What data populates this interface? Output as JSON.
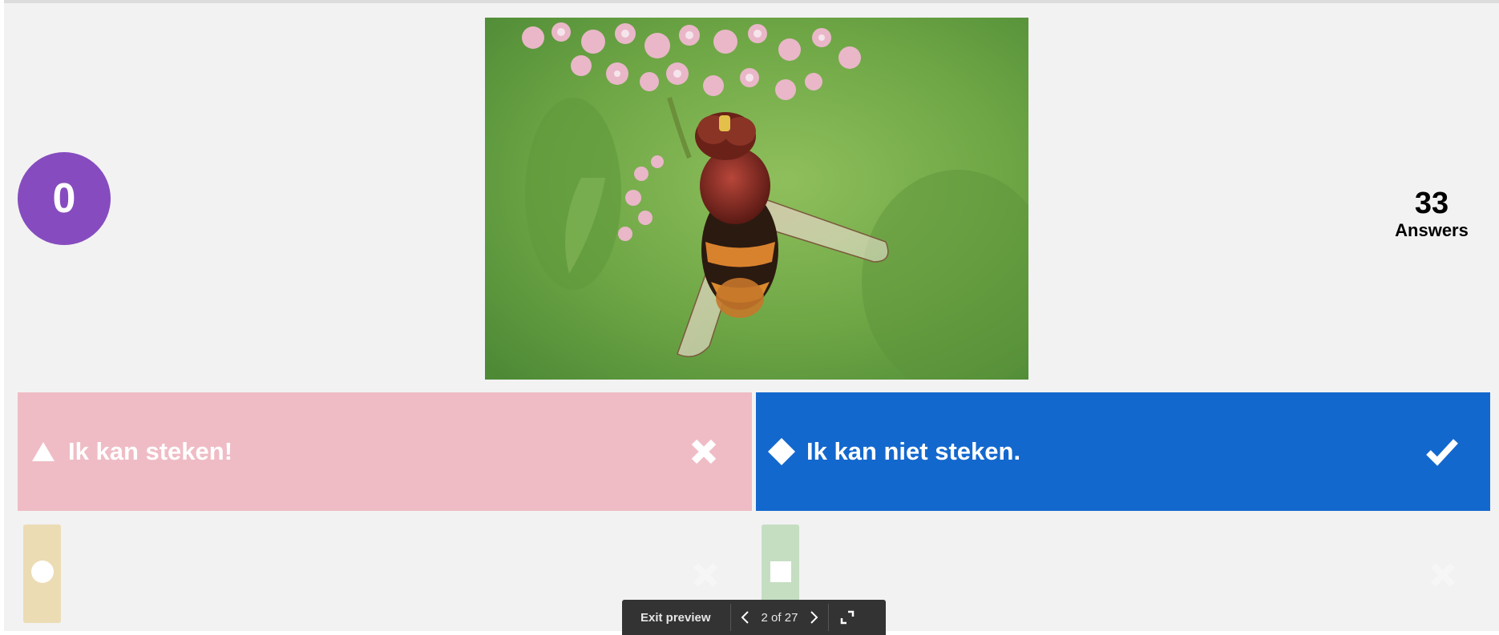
{
  "score": {
    "value": "0",
    "color": "#864cbf"
  },
  "answers_count": {
    "number": "33",
    "label": "Answers"
  },
  "question_image": {
    "subject": "hoverfly on pink flowers",
    "icon": "photo"
  },
  "answers": [
    {
      "shape": "triangle-icon",
      "text": "Ik kan steken!",
      "correct": false,
      "color": "#efbcc5",
      "mark": "cross-icon"
    },
    {
      "shape": "diamond-icon",
      "text": "Ik kan niet steken.",
      "correct": true,
      "color": "#1368ce",
      "mark": "check-icon"
    }
  ],
  "faded_answers": [
    {
      "shape": "circle-icon",
      "color": "#ecdcb4"
    },
    {
      "shape": "square-icon",
      "color": "#c5dec2"
    }
  ],
  "preview_bar": {
    "exit_label": "Exit preview",
    "pager": "2 of 27",
    "prev_icon": "chevron-left-icon",
    "next_icon": "chevron-right-icon",
    "fullscreen_icon": "fullscreen-icon"
  }
}
